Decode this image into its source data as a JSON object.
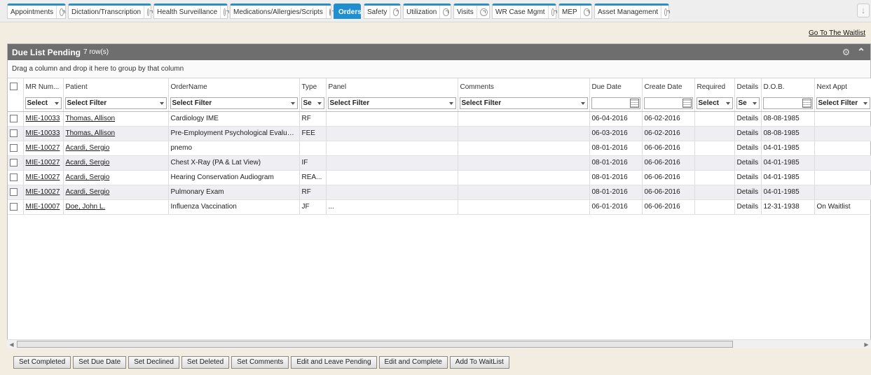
{
  "tabs": [
    {
      "label": "Appointments",
      "active": false
    },
    {
      "label": "Dictation/Transcription",
      "active": false
    },
    {
      "label": "Health Surveillance",
      "active": false
    },
    {
      "label": "Medications/Allergies/Scripts",
      "active": false
    },
    {
      "label": "Orders",
      "active": true
    },
    {
      "label": "Safety",
      "active": false
    },
    {
      "label": "Utilization",
      "active": false
    },
    {
      "label": "Visits",
      "active": false
    },
    {
      "label": "WR Case Mgmt",
      "active": false
    },
    {
      "label": "MEP",
      "active": false
    },
    {
      "label": "Asset Management",
      "active": false
    }
  ],
  "waitlist_link": "Go To The Waitlist",
  "panel": {
    "title": "Due List Pending",
    "count": "7 row(s)",
    "group_hint": "Drag a column and drop it here to group by that column"
  },
  "columns": [
    "MR Num...",
    "Patient",
    "OrderName",
    "Type",
    "Panel",
    "Comments",
    "Due Date",
    "Create Date",
    "Required",
    "Details",
    "D.O.B.",
    "Next Appt"
  ],
  "filters": {
    "mr": "Select",
    "patient": "Select Filter",
    "order": "Select Filter",
    "type": "Se",
    "panel": "Select Filter",
    "comments": "Select Filter",
    "required": "Select",
    "details": "Se",
    "next": "Select Filter"
  },
  "rows": [
    {
      "mr": "MIE-10033",
      "patient": "Thomas, Allison",
      "order": "Cardiology IME",
      "type": "RF",
      "panel": "",
      "comments": "",
      "due": "06-04-2016",
      "created": "06-02-2016",
      "required": "",
      "details": "Details",
      "dob": "08-08-1985",
      "next": ""
    },
    {
      "mr": "MIE-10033",
      "patient": "Thomas, Allison",
      "order": "Pre-Employment Psychological Evaluati...",
      "type": "FEE",
      "panel": "",
      "comments": "",
      "due": "06-03-2016",
      "created": "06-02-2016",
      "required": "",
      "details": "Details",
      "dob": "08-08-1985",
      "next": ""
    },
    {
      "mr": "MIE-10027",
      "patient": "Acardi, Sergio",
      "order": "pnemo",
      "type": "",
      "panel": "",
      "comments": "",
      "due": "08-01-2016",
      "created": "06-06-2016",
      "required": "",
      "details": "Details",
      "dob": "04-01-1985",
      "next": ""
    },
    {
      "mr": "MIE-10027",
      "patient": "Acardi, Sergio",
      "order": "Chest X-Ray (PA & Lat View)",
      "type": "IF",
      "panel": "",
      "comments": "",
      "due": "08-01-2016",
      "created": "06-06-2016",
      "required": "",
      "details": "Details",
      "dob": "04-01-1985",
      "next": ""
    },
    {
      "mr": "MIE-10027",
      "patient": "Acardi, Sergio",
      "order": "Hearing Conservation Audiogram",
      "type": "REA...",
      "panel": "",
      "comments": "",
      "due": "08-01-2016",
      "created": "06-06-2016",
      "required": "",
      "details": "Details",
      "dob": "04-01-1985",
      "next": ""
    },
    {
      "mr": "MIE-10027",
      "patient": "Acardi, Sergio",
      "order": "Pulmonary Exam",
      "type": "RF",
      "panel": "",
      "comments": "",
      "due": "08-01-2016",
      "created": "06-06-2016",
      "required": "",
      "details": "Details",
      "dob": "04-01-1985",
      "next": ""
    },
    {
      "mr": "MIE-10007",
      "patient": "Doe, John L.",
      "order": "Influenza Vaccination",
      "type": "JF",
      "panel": "...",
      "comments": "",
      "due": "06-01-2016",
      "created": "06-06-2016",
      "required": "",
      "details": "Details",
      "dob": "12-31-1938",
      "next": "On Waitlist"
    }
  ],
  "actions": [
    "Set Completed",
    "Set Due Date",
    "Set Declined",
    "Set Deleted",
    "Set Comments",
    "Edit and Leave Pending",
    "Edit and Complete",
    "Add To WaitList"
  ],
  "colors": {
    "accent": "#1f8fcf",
    "header_bg": "#6e6e6e",
    "page_bg": "#f3ece0"
  }
}
